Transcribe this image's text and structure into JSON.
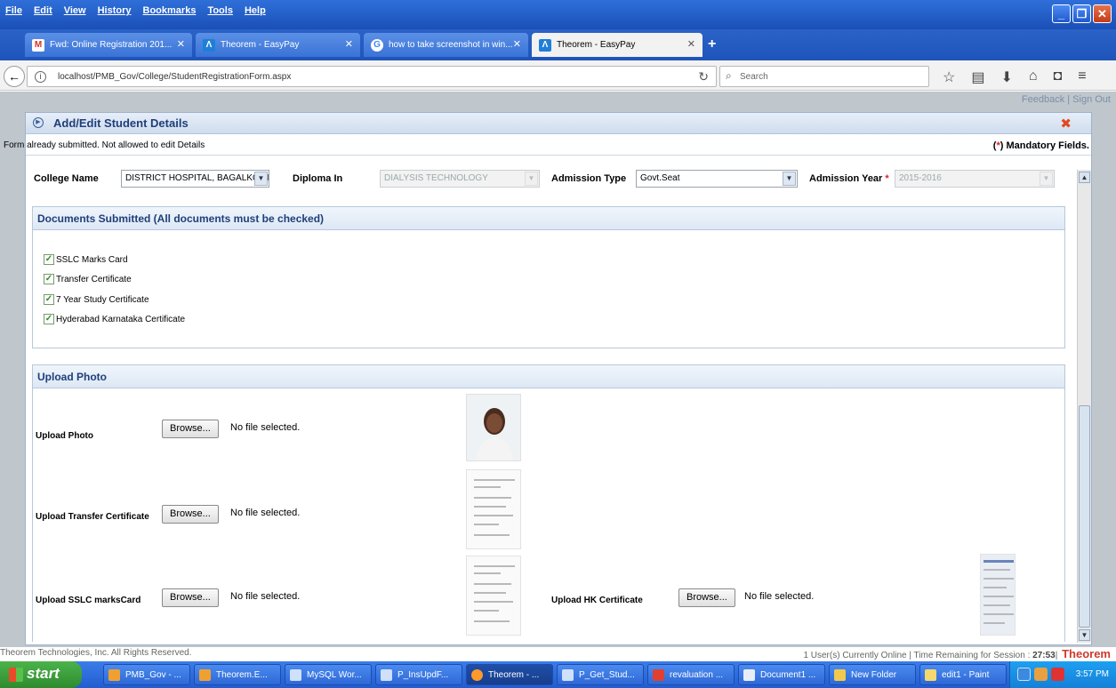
{
  "menu": [
    "File",
    "Edit",
    "View",
    "History",
    "Bookmarks",
    "Tools",
    "Help"
  ],
  "tabs": [
    {
      "label": "Fwd: Online Registration 201...",
      "icon": "gmail-icon"
    },
    {
      "label": "Theorem - EasyPay",
      "icon": "theorem-icon"
    },
    {
      "label": "how to take screenshot in win...",
      "icon": "google-icon"
    },
    {
      "label": "Theorem - EasyPay",
      "icon": "theorem-icon"
    }
  ],
  "address": {
    "url": "localhost/PMB_Gov/College/StudentRegistrationForm.aspx",
    "search_placeholder": "Search"
  },
  "page": {
    "links": "Feedback | Sign Out"
  },
  "modal": {
    "title": "Add/Edit Student Details",
    "message": "Form already submitted. Not allowed to edit Details",
    "mandatory": "Mandatory Fields.",
    "mandatory_open": "(",
    "mandatory_star": "*",
    "mandatory_close": ")"
  },
  "fields": {
    "college_label": "College Name",
    "college_value": "DISTRICT HOSPITAL, BAGALKOT-B",
    "diploma_label": "Diploma In",
    "diploma_value": "DIALYSIS TECHNOLOGY",
    "admission_type_label": "Admission Type",
    "admission_type_value": "Govt.Seat",
    "admission_year_label": "Admission Year",
    "admission_year_value": "2015-2016"
  },
  "documents": {
    "title": "Documents Submitted (All documents must be checked)",
    "items": [
      "SSLC Marks Card",
      "Transfer Certificate",
      "7 Year Study Certificate",
      "Hyderabad Karnataka Certificate"
    ]
  },
  "upload": {
    "title": "Upload Photo",
    "browse_label": "Browse...",
    "no_file": "No file selected.",
    "photo_label": "Upload Photo",
    "transfer_label": "Upload Transfer Certificate",
    "sslc_label": "Upload SSLC marksCard",
    "hk_label": "Upload HK Certificate"
  },
  "footer": {
    "copyright": "Theorem Technologies, Inc. All Rights Reserved.",
    "status_prefix": "1 User(s) Currently Online | Time Remaining for Session : ",
    "session_time": "27:53",
    "brand": "Theorem"
  },
  "taskbar": {
    "start": "start",
    "items": [
      "PMB_Gov - ...",
      "Theorem.E...",
      "MySQL Wor...",
      "P_InsUpdF...",
      "Theorem - ...",
      "P_Get_Stud...",
      "revaluation ...",
      "Document1 ...",
      "New Folder",
      "edit1 - Paint"
    ],
    "clock": "3:57 PM"
  }
}
